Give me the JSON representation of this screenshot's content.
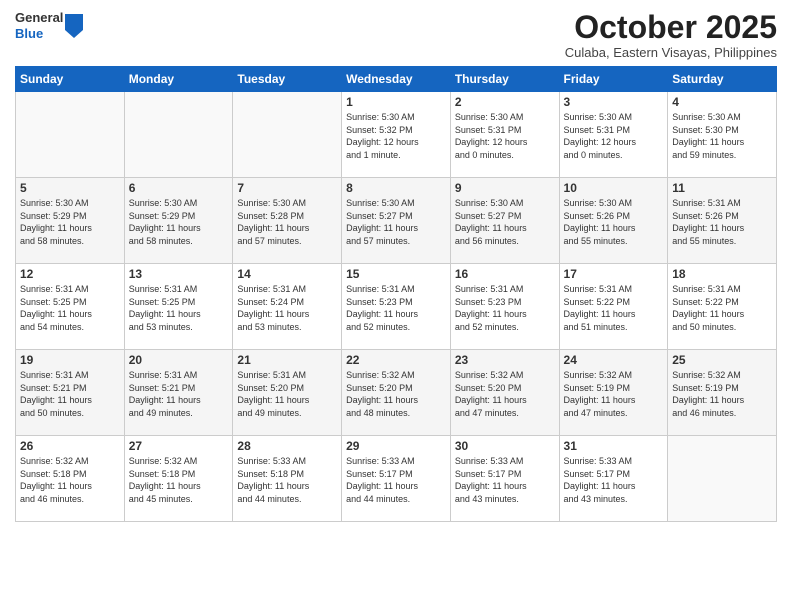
{
  "header": {
    "logo": {
      "general": "General",
      "blue": "Blue"
    },
    "title": "October 2025",
    "location": "Culaba, Eastern Visayas, Philippines"
  },
  "weekdays": [
    "Sunday",
    "Monday",
    "Tuesday",
    "Wednesday",
    "Thursday",
    "Friday",
    "Saturday"
  ],
  "rows": [
    [
      {
        "day": "",
        "content": ""
      },
      {
        "day": "",
        "content": ""
      },
      {
        "day": "",
        "content": ""
      },
      {
        "day": "1",
        "content": "Sunrise: 5:30 AM\nSunset: 5:32 PM\nDaylight: 12 hours\nand 1 minute."
      },
      {
        "day": "2",
        "content": "Sunrise: 5:30 AM\nSunset: 5:31 PM\nDaylight: 12 hours\nand 0 minutes."
      },
      {
        "day": "3",
        "content": "Sunrise: 5:30 AM\nSunset: 5:31 PM\nDaylight: 12 hours\nand 0 minutes."
      },
      {
        "day": "4",
        "content": "Sunrise: 5:30 AM\nSunset: 5:30 PM\nDaylight: 11 hours\nand 59 minutes."
      }
    ],
    [
      {
        "day": "5",
        "content": "Sunrise: 5:30 AM\nSunset: 5:29 PM\nDaylight: 11 hours\nand 58 minutes."
      },
      {
        "day": "6",
        "content": "Sunrise: 5:30 AM\nSunset: 5:29 PM\nDaylight: 11 hours\nand 58 minutes."
      },
      {
        "day": "7",
        "content": "Sunrise: 5:30 AM\nSunset: 5:28 PM\nDaylight: 11 hours\nand 57 minutes."
      },
      {
        "day": "8",
        "content": "Sunrise: 5:30 AM\nSunset: 5:27 PM\nDaylight: 11 hours\nand 57 minutes."
      },
      {
        "day": "9",
        "content": "Sunrise: 5:30 AM\nSunset: 5:27 PM\nDaylight: 11 hours\nand 56 minutes."
      },
      {
        "day": "10",
        "content": "Sunrise: 5:30 AM\nSunset: 5:26 PM\nDaylight: 11 hours\nand 55 minutes."
      },
      {
        "day": "11",
        "content": "Sunrise: 5:31 AM\nSunset: 5:26 PM\nDaylight: 11 hours\nand 55 minutes."
      }
    ],
    [
      {
        "day": "12",
        "content": "Sunrise: 5:31 AM\nSunset: 5:25 PM\nDaylight: 11 hours\nand 54 minutes."
      },
      {
        "day": "13",
        "content": "Sunrise: 5:31 AM\nSunset: 5:25 PM\nDaylight: 11 hours\nand 53 minutes."
      },
      {
        "day": "14",
        "content": "Sunrise: 5:31 AM\nSunset: 5:24 PM\nDaylight: 11 hours\nand 53 minutes."
      },
      {
        "day": "15",
        "content": "Sunrise: 5:31 AM\nSunset: 5:23 PM\nDaylight: 11 hours\nand 52 minutes."
      },
      {
        "day": "16",
        "content": "Sunrise: 5:31 AM\nSunset: 5:23 PM\nDaylight: 11 hours\nand 52 minutes."
      },
      {
        "day": "17",
        "content": "Sunrise: 5:31 AM\nSunset: 5:22 PM\nDaylight: 11 hours\nand 51 minutes."
      },
      {
        "day": "18",
        "content": "Sunrise: 5:31 AM\nSunset: 5:22 PM\nDaylight: 11 hours\nand 50 minutes."
      }
    ],
    [
      {
        "day": "19",
        "content": "Sunrise: 5:31 AM\nSunset: 5:21 PM\nDaylight: 11 hours\nand 50 minutes."
      },
      {
        "day": "20",
        "content": "Sunrise: 5:31 AM\nSunset: 5:21 PM\nDaylight: 11 hours\nand 49 minutes."
      },
      {
        "day": "21",
        "content": "Sunrise: 5:31 AM\nSunset: 5:20 PM\nDaylight: 11 hours\nand 49 minutes."
      },
      {
        "day": "22",
        "content": "Sunrise: 5:32 AM\nSunset: 5:20 PM\nDaylight: 11 hours\nand 48 minutes."
      },
      {
        "day": "23",
        "content": "Sunrise: 5:32 AM\nSunset: 5:20 PM\nDaylight: 11 hours\nand 47 minutes."
      },
      {
        "day": "24",
        "content": "Sunrise: 5:32 AM\nSunset: 5:19 PM\nDaylight: 11 hours\nand 47 minutes."
      },
      {
        "day": "25",
        "content": "Sunrise: 5:32 AM\nSunset: 5:19 PM\nDaylight: 11 hours\nand 46 minutes."
      }
    ],
    [
      {
        "day": "26",
        "content": "Sunrise: 5:32 AM\nSunset: 5:18 PM\nDaylight: 11 hours\nand 46 minutes."
      },
      {
        "day": "27",
        "content": "Sunrise: 5:32 AM\nSunset: 5:18 PM\nDaylight: 11 hours\nand 45 minutes."
      },
      {
        "day": "28",
        "content": "Sunrise: 5:33 AM\nSunset: 5:18 PM\nDaylight: 11 hours\nand 44 minutes."
      },
      {
        "day": "29",
        "content": "Sunrise: 5:33 AM\nSunset: 5:17 PM\nDaylight: 11 hours\nand 44 minutes."
      },
      {
        "day": "30",
        "content": "Sunrise: 5:33 AM\nSunset: 5:17 PM\nDaylight: 11 hours\nand 43 minutes."
      },
      {
        "day": "31",
        "content": "Sunrise: 5:33 AM\nSunset: 5:17 PM\nDaylight: 11 hours\nand 43 minutes."
      },
      {
        "day": "",
        "content": ""
      }
    ]
  ]
}
